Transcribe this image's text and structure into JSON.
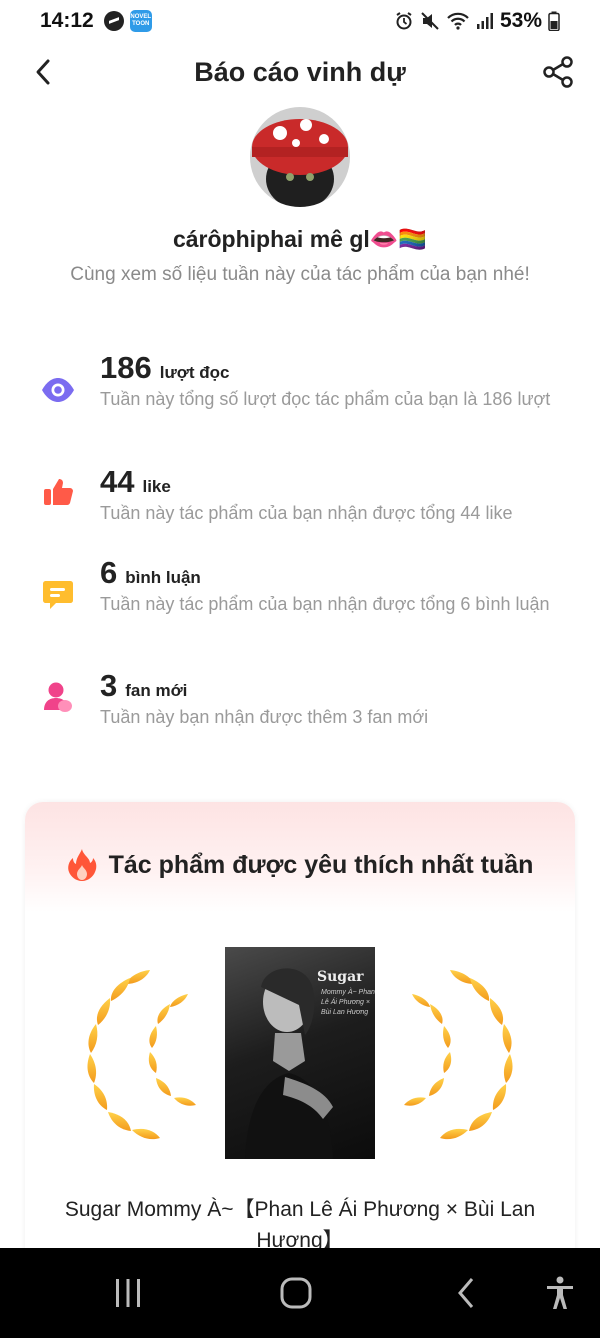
{
  "status_bar": {
    "time": "14:12",
    "battery": "53%",
    "icons": [
      "messenger-icon",
      "noveltoon-icon",
      "alarm-icon",
      "mute-icon",
      "wifi-icon",
      "signal-icon",
      "battery-icon"
    ],
    "novel_icon_text_1": "NOVEL",
    "novel_icon_text_2": "TOON"
  },
  "header": {
    "title": "Báo cáo vinh dự"
  },
  "profile": {
    "username": "cárôphiphai mê gl👄🏳️‍🌈",
    "subtitle": "Cùng xem số liệu tuần này của tác phẩm của bạn nhé!"
  },
  "stats": [
    {
      "icon": "eye-icon",
      "number": "186",
      "unit": "lượt đọc",
      "desc": "Tuần này tổng số lượt đọc tác phẩm của bạn là 186 lượt",
      "color": "#7b6cf0"
    },
    {
      "icon": "thumbs-up-icon",
      "number": "44",
      "unit": "like",
      "desc": "Tuần này tác phẩm của bạn nhận được tổng 44 like",
      "color": "#ff5a48"
    },
    {
      "icon": "comment-icon",
      "number": "6",
      "unit": "bình luận",
      "desc": "Tuần này tác phẩm của bạn nhận được tổng 6 bình luận",
      "color": "#ffbd2e"
    },
    {
      "icon": "user-icon",
      "number": "3",
      "unit": "fan mới",
      "desc": "Tuần này bạn nhận được thêm 3 fan mới",
      "color": "#f0438a"
    }
  ],
  "card": {
    "title": "Tác phẩm được yêu thích nhất tuần",
    "cover_title": "Sugar",
    "cover_lines": [
      "Mommy À~ Phan",
      "Lê Ái Phương ×",
      "Bùi Lan Hương"
    ],
    "book_title": "Sugar Mommy À~【Phan Lê Ái Phương × Bùi Lan Hương】"
  },
  "colors": {
    "accent_purple": "#7b6cf0",
    "accent_red": "#ff5a48",
    "accent_yellow": "#ffbd2e",
    "accent_pink": "#f0438a",
    "laurel_gold": "#f5a623"
  }
}
